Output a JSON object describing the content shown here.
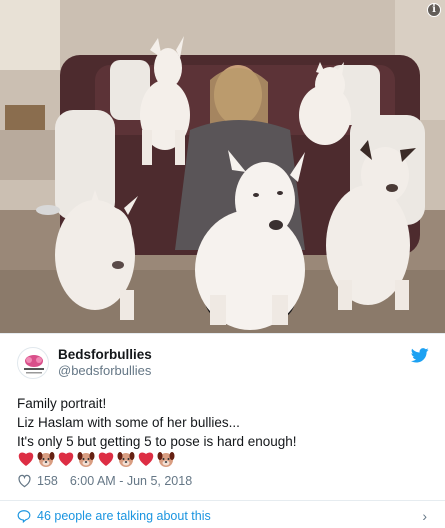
{
  "photo": {
    "info_icon": "info-icon",
    "colors": {
      "wall": "#cfc3b6",
      "couch": "#4d2b2e",
      "dogs": "#f2ede8",
      "floor": "#9a8878"
    }
  },
  "tweet": {
    "display_name": "Bedsforbullies",
    "handle": "@bedsforbullies",
    "text_lines": [
      "Family portrait!",
      "Liz Haslam with some of her bullies...",
      "It's only 5 but getting 5 to pose is hard enough!"
    ],
    "emojis": [
      "red-heart-icon",
      "dog-face-icon",
      "red-heart-icon",
      "dog-face-icon",
      "red-heart-icon",
      "dog-face-icon",
      "red-heart-icon",
      "dog-face-icon"
    ],
    "like_count": "158",
    "timestamp": "6:00 AM - Jun 5, 2018",
    "talking": "46 people are talking about this",
    "colors": {
      "link": "#1b95e0",
      "meta": "#657786",
      "heart": "#e0245e"
    }
  }
}
